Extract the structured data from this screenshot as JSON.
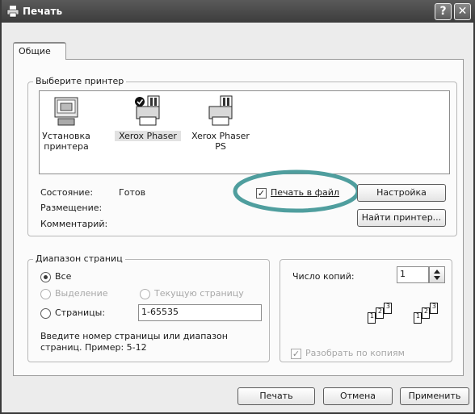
{
  "window": {
    "title": "Печать",
    "help_label": "?",
    "close_label": "✕"
  },
  "tabs": [
    {
      "label": "Общие"
    }
  ],
  "printer_group": {
    "title": "Выберите принтер",
    "printers": [
      {
        "label_line1": "Установка",
        "label_line2": "принтера",
        "icon": "add-printer-icon",
        "selected": false,
        "default": false
      },
      {
        "label_line1": "Xerox Phaser",
        "label_line2": "",
        "icon": "printer-icon",
        "selected": true,
        "default": true
      },
      {
        "label_line1": "Xerox Phaser",
        "label_line2": "PS",
        "icon": "printer-icon",
        "selected": false,
        "default": false
      }
    ],
    "status_label": "Состояние:",
    "status_value": "Готов",
    "location_label": "Размещение:",
    "comment_label": "Комментарий:",
    "print_to_file_label": "Печать в файл",
    "print_to_file_checked": true,
    "settings_button": "Настройка",
    "find_printer_button": "Найти принтер..."
  },
  "range_group": {
    "title": "Диапазон страниц",
    "all_label": "Все",
    "selection_label": "Выделение",
    "current_page_label": "Текущую страницу",
    "pages_label": "Страницы:",
    "pages_value": "1-65535",
    "hint_line1": "Введите номер страницы или диапазон",
    "hint_line2": "страниц. Пример: 5-12",
    "selected_option": "all"
  },
  "copies_group": {
    "copies_label": "Число копий:",
    "copies_value": "1",
    "collate_label": "Разобрать по копиям",
    "collate_checked": true,
    "collate_pages": [
      "1",
      "2",
      "3"
    ]
  },
  "footer": {
    "print_button": "Печать",
    "cancel_button": "Отмена",
    "apply_button": "Применить"
  },
  "colors": {
    "highlight_ring": "#4f9e9e"
  }
}
